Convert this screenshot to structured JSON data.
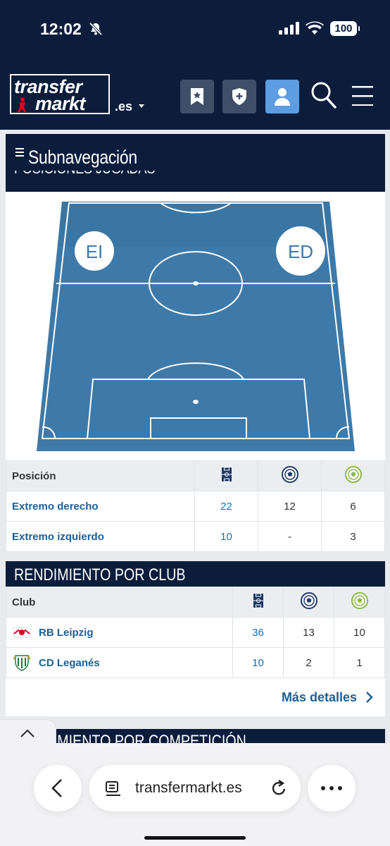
{
  "status_bar": {
    "time": "12:02",
    "battery": "100"
  },
  "header": {
    "logo_top": "transfer",
    "logo_bottom": "markt",
    "domain": ".es",
    "icons": [
      "bookmark-star-icon",
      "shield-plus-icon",
      "user-icon",
      "search-icon",
      "menu-icon"
    ],
    "accent": "#5d9de2",
    "navy": "#0c1d3c"
  },
  "subnav": {
    "label": "Subnavegación",
    "cut_heading": "POSICIONES JUGADAS"
  },
  "pitch": {
    "positions": [
      {
        "abbr": "EI"
      },
      {
        "abbr": "ED"
      }
    ],
    "pitch_color": "#3d7aa9"
  },
  "positions_table": {
    "header": "Posición",
    "column_icons": [
      "pitch-icon",
      "football-icon",
      "assist-ball-icon"
    ],
    "rows": [
      {
        "name": "Extremo derecho",
        "apps": "22",
        "goals": "12",
        "assists": "6"
      },
      {
        "name": "Extremo izquierdo",
        "apps": "10",
        "goals": "-",
        "assists": "3"
      }
    ]
  },
  "club_section": {
    "title": "RENDIMIENTO POR CLUB",
    "header": "Club",
    "rows": [
      {
        "club": "RB Leipzig",
        "crest": "rb-leipzig-crest-icon",
        "apps": "36",
        "goals": "13",
        "assists": "10"
      },
      {
        "club": "CD Leganés",
        "crest": "cd-leganes-crest-icon",
        "apps": "10",
        "goals": "2",
        "assists": "1"
      }
    ],
    "more_label": "Más detalles"
  },
  "comp_section": {
    "title": "RENDIMIENTO POR COMPETICIÓN"
  },
  "browser": {
    "url": "transfermarkt.es"
  }
}
